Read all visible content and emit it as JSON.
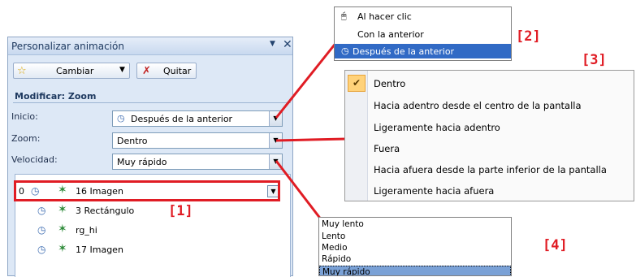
{
  "pane": {
    "title": "Personalizar animación",
    "change_label": "Cambiar",
    "remove_label": "Quitar",
    "section_header": "Modificar: Zoom",
    "start_label": "Inicio:",
    "start_value": "Después de la anterior",
    "zoom_label": "Zoom:",
    "zoom_value": "Dentro",
    "speed_label": "Velocidad:",
    "speed_value": "Muy rápido",
    "list": [
      {
        "num": "0",
        "name": "16 Imagen"
      },
      {
        "num": "",
        "name": "3 Rectángulo"
      },
      {
        "num": "",
        "name": "rg_hi"
      },
      {
        "num": "",
        "name": "17 Imagen"
      }
    ]
  },
  "start_menu": {
    "items": [
      "Al hacer clic",
      "Con la anterior",
      "Después de la anterior"
    ],
    "selected": 2
  },
  "zoom_menu": {
    "items": [
      "Dentro",
      "Hacia adentro desde el centro de la pantalla",
      "Ligeramente hacia adentro",
      "Fuera",
      "Hacia afuera desde la parte inferior de la pantalla",
      "Ligeramente hacia afuera"
    ],
    "checked": 0
  },
  "speed_menu": {
    "items": [
      "Muy lento",
      "Lento",
      "Medio",
      "Rápido",
      "Muy rápido"
    ],
    "selected": 4
  },
  "callouts": {
    "c1": "[1]",
    "c2": "[2]",
    "c3": "[3]",
    "c4": "[4]"
  },
  "colors": {
    "highlight": "#e01c24",
    "selection": "#316ac5"
  },
  "icons": {
    "pane_menu": "▼",
    "pane_close": "✕",
    "dropdown": "▼",
    "change": "☆",
    "remove": "✗",
    "clock": "◷",
    "effect": "✶",
    "check": "✔",
    "mouse": "🖱"
  }
}
